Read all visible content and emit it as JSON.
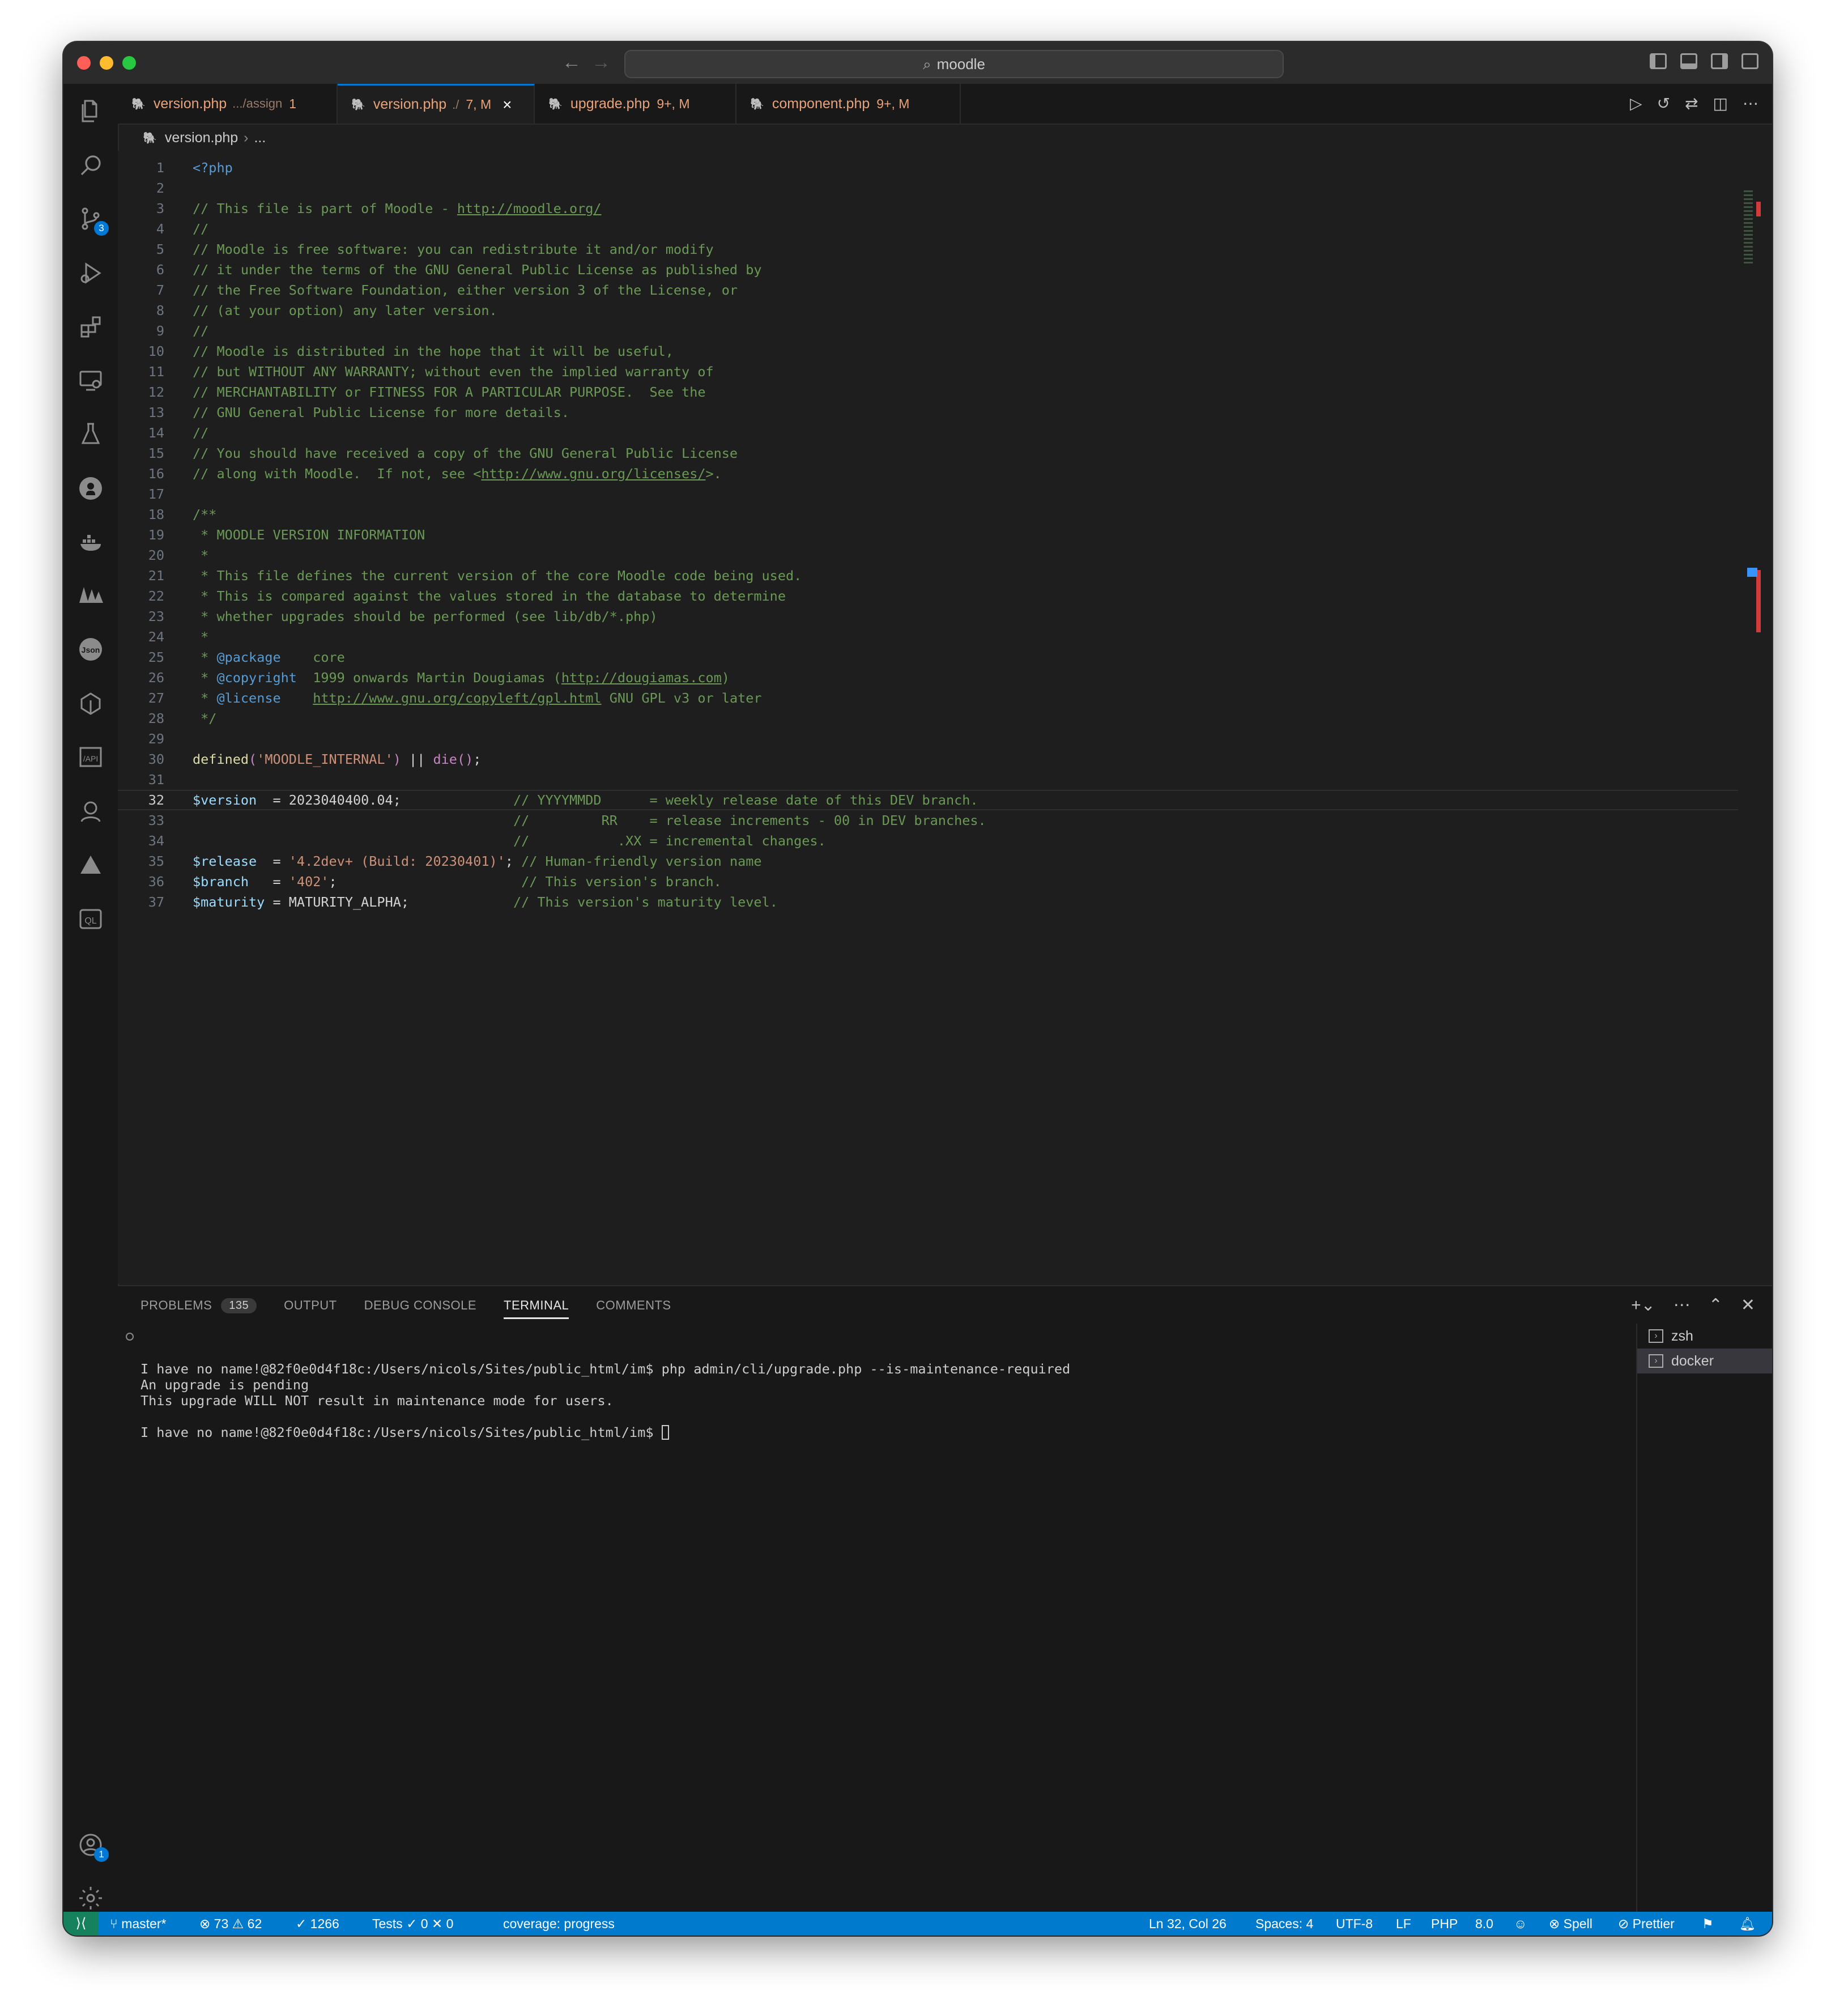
{
  "title_bar": {
    "search": "moodle"
  },
  "tabs": [
    {
      "icon": "php",
      "name": "version.php",
      "desc": ".../assign",
      "count": "1"
    },
    {
      "icon": "php",
      "name": "version.php",
      "desc": "./",
      "count": "7, M",
      "close": "×"
    },
    {
      "icon": "php",
      "name": "upgrade.php",
      "count": "9+, M"
    },
    {
      "icon": "php",
      "name": "component.php",
      "count": "9+, M"
    }
  ],
  "breadcrumb": {
    "file": "version.php",
    "rest": "..."
  },
  "activity_bar": {
    "source_control_badge": "3",
    "accounts_badge": "1",
    "icons": [
      "explorer-icon",
      "search-icon",
      "source-control-icon",
      "run-debug-icon",
      "extensions-icon",
      "remote-explorer-icon",
      "testing-icon",
      "github-icon",
      "docker-icon",
      "trees-icon",
      "json-icon",
      "ext-icon",
      "api-icon",
      "agent-icon",
      "triangle-icon",
      "ql-icon",
      "accounts-icon",
      "settings-gear-icon"
    ]
  },
  "code": {
    "lines": [
      {
        "n": "1",
        "t": [
          [
            "tag",
            "<?php"
          ]
        ]
      },
      {
        "n": "2",
        "t": []
      },
      {
        "n": "3",
        "t": [
          [
            "com",
            "// This file is part of Moodle - "
          ],
          [
            "comlink",
            "http://moodle.org/"
          ]
        ]
      },
      {
        "n": "4",
        "t": [
          [
            "com",
            "//"
          ]
        ]
      },
      {
        "n": "5",
        "t": [
          [
            "com",
            "// Moodle is free software: you can redistribute it and/or modify"
          ]
        ]
      },
      {
        "n": "6",
        "t": [
          [
            "com",
            "// it under the terms of the GNU General Public License as published by"
          ]
        ]
      },
      {
        "n": "7",
        "t": [
          [
            "com",
            "// the Free Software Foundation, either version 3 of the License, or"
          ]
        ]
      },
      {
        "n": "8",
        "t": [
          [
            "com",
            "// (at your option) any later version."
          ]
        ]
      },
      {
        "n": "9",
        "t": [
          [
            "com",
            "//"
          ]
        ]
      },
      {
        "n": "10",
        "t": [
          [
            "com",
            "// Moodle is distributed in the hope that it will be useful,"
          ]
        ]
      },
      {
        "n": "11",
        "t": [
          [
            "com",
            "// but WITHOUT ANY WARRANTY; without even the implied warranty of"
          ]
        ]
      },
      {
        "n": "12",
        "t": [
          [
            "com",
            "// MERCHANTABILITY or FITNESS FOR A PARTICULAR PURPOSE.  See the"
          ]
        ]
      },
      {
        "n": "13",
        "t": [
          [
            "com",
            "// GNU General Public License for more details."
          ]
        ]
      },
      {
        "n": "14",
        "t": [
          [
            "com",
            "//"
          ]
        ]
      },
      {
        "n": "15",
        "t": [
          [
            "com",
            "// You should have received a copy of the GNU General Public License"
          ]
        ]
      },
      {
        "n": "16",
        "t": [
          [
            "com",
            "// along with Moodle.  If not, see <"
          ],
          [
            "comlink",
            "http://www.gnu.org/licenses/"
          ],
          [
            "com",
            ">."
          ]
        ]
      },
      {
        "n": "17",
        "t": []
      },
      {
        "n": "18",
        "t": [
          [
            "com",
            "/**"
          ]
        ]
      },
      {
        "n": "19",
        "t": [
          [
            "com",
            " * MOODLE VERSION INFORMATION"
          ]
        ]
      },
      {
        "n": "20",
        "t": [
          [
            "com",
            " *"
          ]
        ]
      },
      {
        "n": "21",
        "t": [
          [
            "com",
            " * This file defines the current version of the core Moodle code being used."
          ]
        ]
      },
      {
        "n": "22",
        "t": [
          [
            "com",
            " * This is compared against the values stored in the database to determine"
          ]
        ]
      },
      {
        "n": "23",
        "t": [
          [
            "com",
            " * whether upgrades should be performed (see lib/db/*.php)"
          ]
        ]
      },
      {
        "n": "24",
        "t": [
          [
            "com",
            " *"
          ]
        ]
      },
      {
        "n": "25",
        "t": [
          [
            "com",
            " * "
          ],
          [
            "tag",
            "@package"
          ],
          [
            "com",
            "    core"
          ]
        ]
      },
      {
        "n": "26",
        "t": [
          [
            "com",
            " * "
          ],
          [
            "tag",
            "@copyright"
          ],
          [
            "com",
            "  1999 onwards Martin Dougiamas ("
          ],
          [
            "comlink",
            "http://dougiamas.com"
          ],
          [
            "com",
            ")"
          ]
        ]
      },
      {
        "n": "27",
        "t": [
          [
            "com",
            " * "
          ],
          [
            "tag",
            "@license"
          ],
          [
            "com",
            "    "
          ],
          [
            "comlink",
            "http://www.gnu.org/copyleft/gpl.html"
          ],
          [
            "com",
            " GNU GPL v3 or later"
          ]
        ]
      },
      {
        "n": "28",
        "t": [
          [
            "com",
            " */"
          ]
        ]
      },
      {
        "n": "29",
        "t": []
      },
      {
        "n": "30",
        "t": [
          [
            "fn",
            "defined"
          ],
          [
            "kw",
            "("
          ],
          [
            "str",
            "'MOODLE_INTERNAL'"
          ],
          [
            "kw",
            ")"
          ],
          [
            "def",
            " || "
          ],
          [
            "kw",
            "die"
          ],
          [
            "kw",
            "()"
          ],
          [
            "def",
            ";"
          ]
        ]
      },
      {
        "n": "31",
        "t": []
      },
      {
        "n": "32",
        "t": [
          [
            "var",
            "$version"
          ],
          [
            "def",
            "  = 2023040400.04;              "
          ],
          [
            "com",
            "// YYYYMMDD      = weekly release date of this DEV branch."
          ]
        ]
      },
      {
        "n": "33",
        "t": [
          [
            "def",
            "                                        "
          ],
          [
            "com",
            "//         RR    = release increments - 00 in DEV branches."
          ]
        ]
      },
      {
        "n": "34",
        "t": [
          [
            "def",
            "                                        "
          ],
          [
            "com",
            "//           .XX = incremental changes."
          ]
        ]
      },
      {
        "n": "35",
        "t": [
          [
            "var",
            "$release"
          ],
          [
            "def",
            "  = "
          ],
          [
            "str",
            "'4.2dev+ (Build: 20230401)'"
          ],
          [
            "def",
            "; "
          ],
          [
            "com",
            "// Human-friendly version name"
          ]
        ]
      },
      {
        "n": "36",
        "t": [
          [
            "var",
            "$branch"
          ],
          [
            "def",
            "   = "
          ],
          [
            "str",
            "'402'"
          ],
          [
            "def",
            ";                       "
          ],
          [
            "com",
            "// This version's branch."
          ]
        ]
      },
      {
        "n": "37",
        "t": [
          [
            "var",
            "$maturity"
          ],
          [
            "def",
            " = MATURITY_ALPHA;             "
          ],
          [
            "com",
            "// This version's maturity level."
          ]
        ]
      }
    ]
  },
  "panel": {
    "tabs": {
      "problems": "PROBLEMS",
      "problems_count": "135",
      "output": "OUTPUT",
      "debug": "DEBUG CONSOLE",
      "terminal": "TERMINAL",
      "comments": "COMMENTS"
    },
    "terminal_lines": [
      "I have no name!@82f0e0d4f18c:/Users/nicols/Sites/public_html/im$ php admin/cli/upgrade.php --is-maintenance-required",
      "An upgrade is pending",
      "This upgrade WILL NOT result in maintenance mode for users.",
      "",
      "I have no name!@82f0e0d4f18c:/Users/nicols/Sites/public_html/im$ "
    ],
    "terminals": [
      "zsh",
      "docker"
    ]
  },
  "status_bar": {
    "branch": "master*",
    "errors": "73",
    "warnings": "62",
    "checks": "1266",
    "tests_label": "Tests",
    "tests_pass": "0",
    "tests_fail": "0",
    "coverage": "coverage: progress",
    "position": "Ln 32, Col 26",
    "spaces": "Spaces: 4",
    "encoding": "UTF-8",
    "eol": "LF",
    "language": "PHP",
    "php_version": "8.0",
    "spell": "Spell",
    "prettier": "Prettier"
  }
}
